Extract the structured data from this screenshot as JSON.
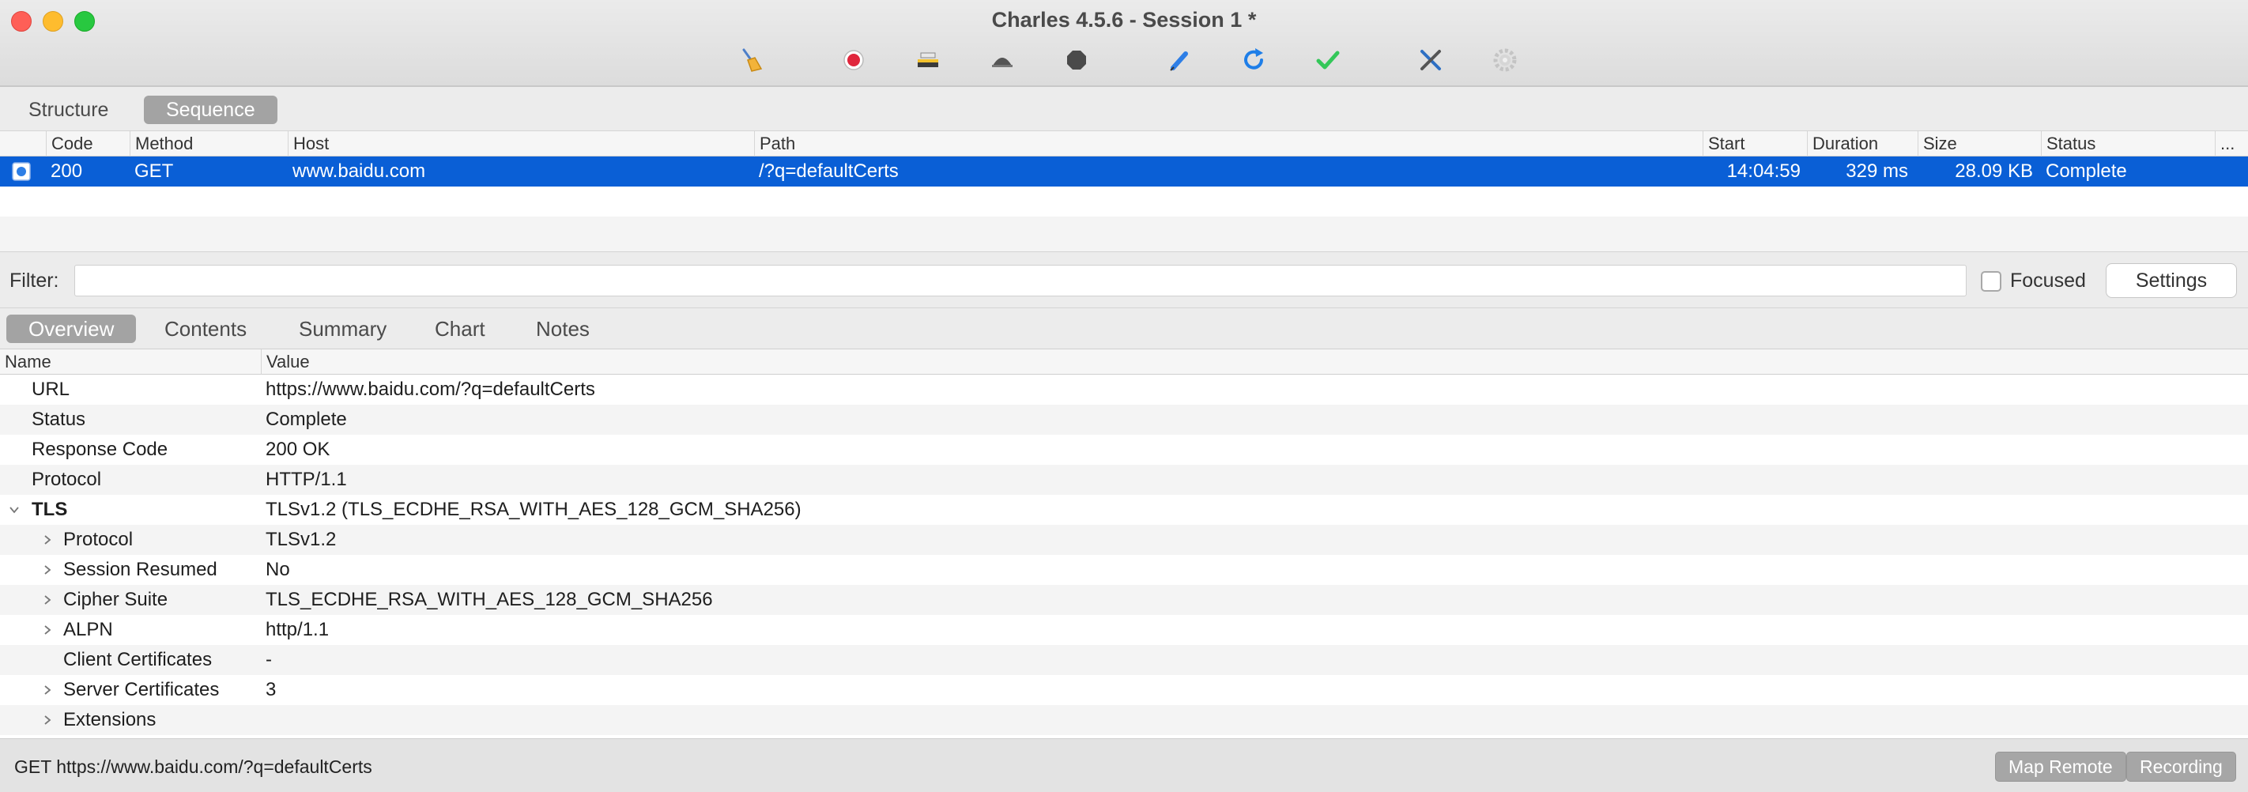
{
  "window": {
    "title": "Charles 4.5.6 - Session 1 *"
  },
  "toolbar": {
    "icons": [
      "broom-icon",
      "record-icon",
      "throttle-icon",
      "turtle-icon",
      "stop-icon",
      "pen-icon",
      "refresh-icon",
      "check-icon",
      "tools-icon",
      "gear-icon"
    ]
  },
  "view_tabs": {
    "structure": "Structure",
    "sequence": "Sequence",
    "selected": "Sequence"
  },
  "sequence": {
    "columns": {
      "code": "Code",
      "method": "Method",
      "host": "Host",
      "path": "Path",
      "start": "Start",
      "duration": "Duration",
      "size": "Size",
      "status": "Status",
      "more": "..."
    },
    "rows": [
      {
        "code": "200",
        "method": "GET",
        "host": "www.baidu.com",
        "path": "/?q=defaultCerts",
        "start": "14:04:59",
        "duration": "329 ms",
        "size": "28.09 KB",
        "status": "Complete"
      }
    ]
  },
  "filter": {
    "label": "Filter:",
    "value": "",
    "focused_label": "Focused",
    "focused_checked": false,
    "settings_label": "Settings"
  },
  "detail_tabs": {
    "overview": "Overview",
    "contents": "Contents",
    "summary": "Summary",
    "chart": "Chart",
    "notes": "Notes",
    "selected": "Overview"
  },
  "overview": {
    "columns": {
      "name": "Name",
      "value": "Value"
    },
    "rows": [
      {
        "name": "URL",
        "value": "https://www.baidu.com/?q=defaultCerts"
      },
      {
        "name": "Status",
        "value": "Complete"
      },
      {
        "name": "Response Code",
        "value": "200 OK"
      },
      {
        "name": "Protocol",
        "value": "HTTP/1.1"
      },
      {
        "name": "TLS",
        "value": "TLSv1.2 (TLS_ECDHE_RSA_WITH_AES_128_GCM_SHA256)"
      },
      {
        "name": "Protocol",
        "value": "TLSv1.2"
      },
      {
        "name": "Session Resumed",
        "value": "No"
      },
      {
        "name": "Cipher Suite",
        "value": "TLS_ECDHE_RSA_WITH_AES_128_GCM_SHA256"
      },
      {
        "name": "ALPN",
        "value": "http/1.1"
      },
      {
        "name": "Client Certificates",
        "value": "-"
      },
      {
        "name": "Server Certificates",
        "value": "3"
      },
      {
        "name": "Extensions",
        "value": ""
      }
    ]
  },
  "statusbar": {
    "text": "GET https://www.baidu.com/?q=defaultCerts",
    "map_remote": "Map Remote",
    "recording": "Recording"
  },
  "colors": {
    "selection": "#0a5fd6",
    "active_tab": "#a3a3a3",
    "record": "#e0263c",
    "check": "#34c759",
    "refresh": "#1e7ee8"
  }
}
